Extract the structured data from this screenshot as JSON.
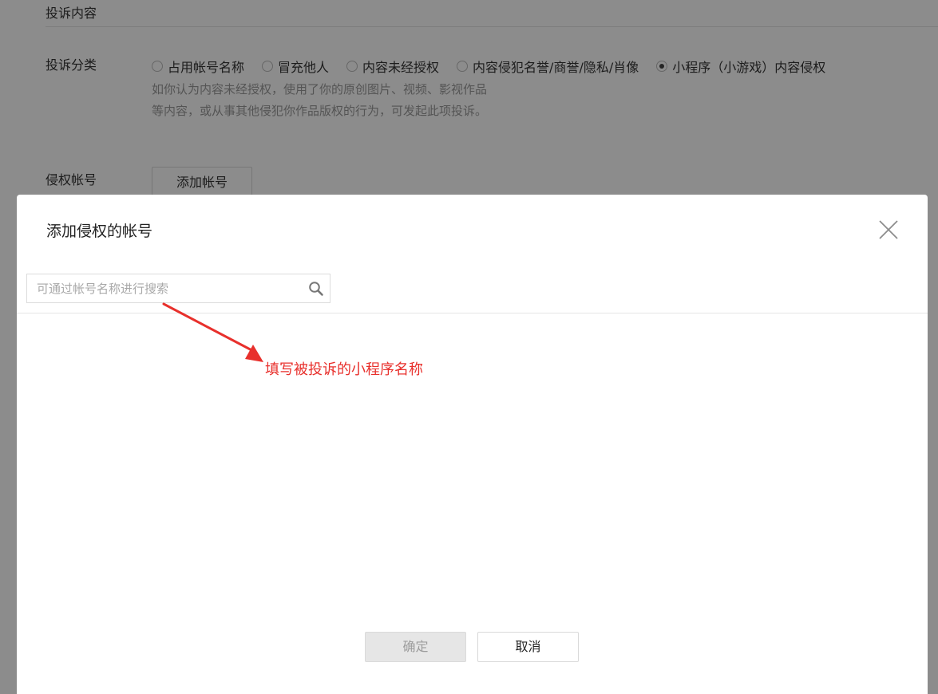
{
  "page": {
    "section_title": "投诉内容",
    "category_label": "投诉分类",
    "categories": [
      {
        "label": "占用帐号名称",
        "checked": false
      },
      {
        "label": "冒充他人",
        "checked": false
      },
      {
        "label": "内容未经授权",
        "checked": false
      },
      {
        "label": "内容侵犯名誉/商誉/隐私/肖像",
        "checked": false
      },
      {
        "label": "小程序（小游戏）内容侵权",
        "checked": true
      }
    ],
    "category_description": "如你认为内容未经授权，使用了你的原创图片、视频、影视作品等内容，或从事其他侵犯你作品版权的行为，可发起此项投诉。",
    "infringing_account_label": "侵权帐号",
    "add_account_button": "添加帐号"
  },
  "dialog": {
    "title": "添加侵权的帐号",
    "search_placeholder": "可通过帐号名称进行搜索",
    "search_value": "",
    "annotation": "填写被投诉的小程序名称",
    "confirm_label": "确定",
    "confirm_disabled": true,
    "cancel_label": "取消"
  },
  "colors": {
    "annotation": "#e8302c",
    "overlay": "rgba(0,0,0,0.45)"
  },
  "icons": {
    "close": "close-icon",
    "search": "search-icon",
    "arrow": "arrow-icon"
  }
}
